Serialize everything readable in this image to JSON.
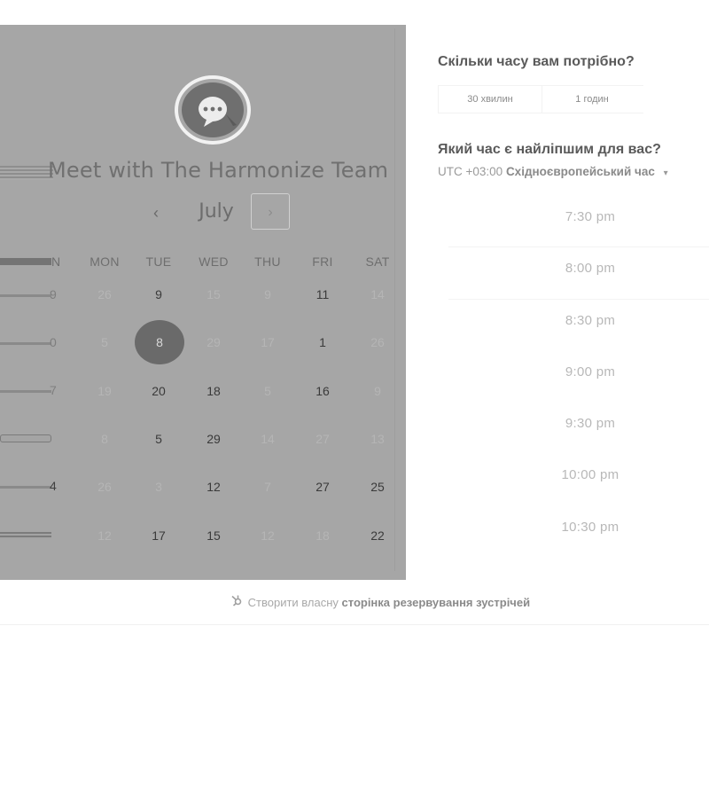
{
  "calendar": {
    "title": "Meet with The Harmonize Team",
    "month": "July",
    "prev_icon": "‹",
    "next_icon": "›",
    "weekdays": [
      "MON",
      "TUE",
      "WED",
      "THU",
      "FRI",
      "SAT"
    ],
    "sunday_partial": "N",
    "rows": [
      {
        "sun": "9",
        "cells": [
          "26",
          "9",
          "15",
          "9",
          "11",
          "14"
        ]
      },
      {
        "sun": "0",
        "cells": [
          "5",
          "8",
          "29",
          "17",
          "1",
          "26"
        ]
      },
      {
        "sun": "7",
        "cells": [
          "19",
          "20",
          "18",
          "5",
          "16",
          "9"
        ]
      },
      {
        "sun": "",
        "cells": [
          "8",
          "5",
          "29",
          "14",
          "27",
          "13"
        ]
      },
      {
        "sun": "4",
        "cells": [
          "26",
          "3",
          "12",
          "7",
          "27",
          "25"
        ]
      },
      {
        "sun": "",
        "cells": [
          "12",
          "17",
          "15",
          "12",
          "18",
          "22"
        ]
      }
    ],
    "selected_day": "8"
  },
  "booking": {
    "duration_question": "Скільки часу вам потрібно?",
    "durations": [
      "30 хвилин",
      "1 годин"
    ],
    "time_question": "Який час є найліпшим для вас?",
    "timezone_offset": "UTC +03:00",
    "timezone_name": "Східноєвропейський час",
    "timezone_caret": "▾",
    "slots": [
      "7:30 pm",
      "8:00 pm",
      "8:30 pm",
      "9:00 pm",
      "9:30 pm",
      "10:00 pm",
      "10:30 pm"
    ]
  },
  "footer": {
    "prefix": "Створити власну",
    "bold": "сторінка резервування зустрічей"
  },
  "colors": {
    "overlay": "#a6a6a6",
    "selected": "#6a6a6a"
  }
}
